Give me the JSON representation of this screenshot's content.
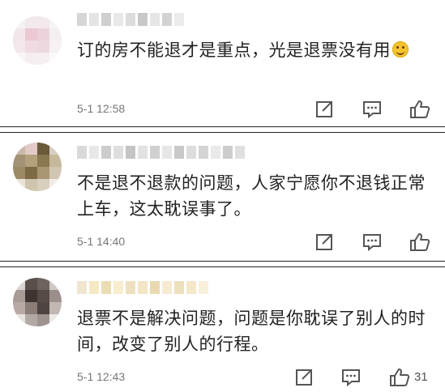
{
  "comments": [
    {
      "text": "订的房不能退才是重点，光是退票没有用",
      "emoji": "laughing-tears-emoji",
      "time": "5-1 12:58",
      "likes": ""
    },
    {
      "text": "不是退不退款的问题，人家宁愿你不退钱正常上车，这太耽误事了。",
      "time": "5-1 14:40",
      "likes": ""
    },
    {
      "text": "退票不是解决问题，问题是你耽误了别人的时间，改变了别人的行程。",
      "time": "5-1 12:43",
      "likes": "31"
    }
  ],
  "icons": {
    "share": "share-icon",
    "reply": "reply-icon",
    "like": "like-icon"
  },
  "colors": {
    "text": "#222222",
    "meta": "#777777",
    "icon": "#555555"
  }
}
